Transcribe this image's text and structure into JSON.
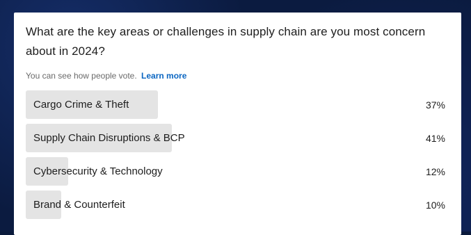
{
  "poll": {
    "question": "What are the key areas or challenges in supply chain are you most concern about in 2024?",
    "visibility_note": "You can see how people vote.",
    "learn_more": "Learn more",
    "options": [
      {
        "label": "Cargo Crime & Theft",
        "percent_text": "37%",
        "percent": 37
      },
      {
        "label": "Supply Chain Disruptions & BCP",
        "percent_text": "41%",
        "percent": 41
      },
      {
        "label": "Cybersecurity & Technology",
        "percent_text": "12%",
        "percent": 12
      },
      {
        "label": "Brand & Counterfeit",
        "percent_text": "10%",
        "percent": 10
      }
    ]
  },
  "colors": {
    "bar_fill": "#e4e4e4",
    "link": "#0a66c2",
    "background": "#0b1b40"
  }
}
